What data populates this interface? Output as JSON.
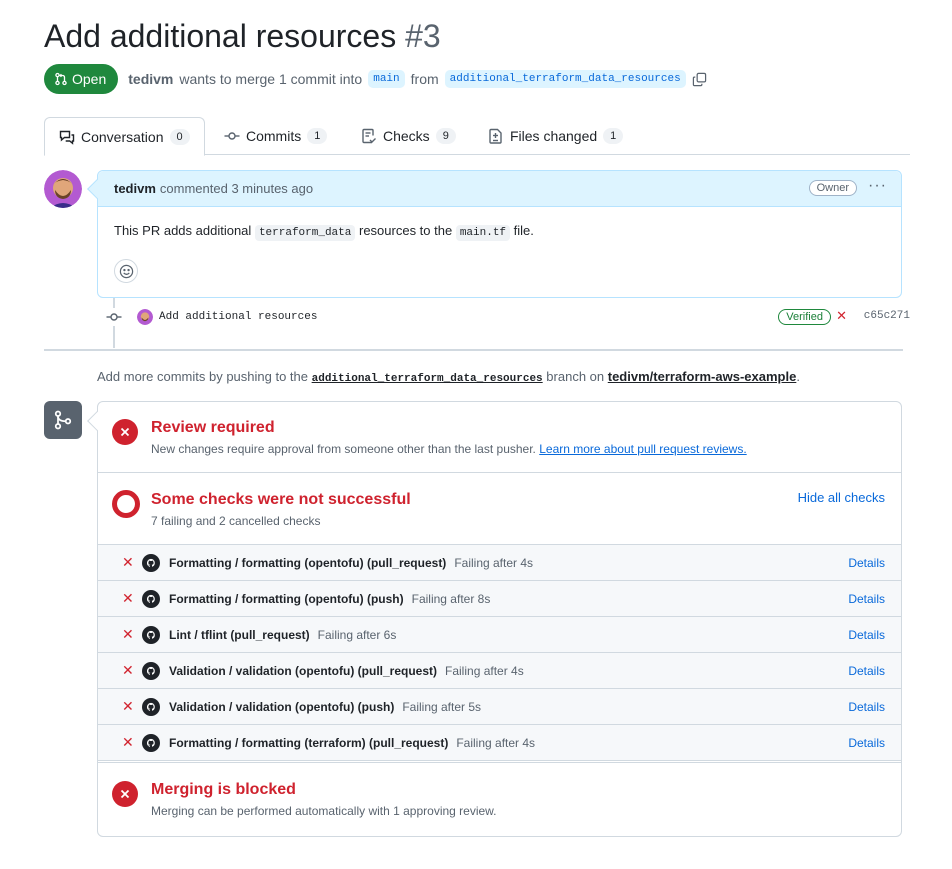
{
  "pr": {
    "title": "Add additional resources",
    "number": "#3",
    "state": "Open",
    "author": "tedivm",
    "merge_text": "wants to merge 1 commit into",
    "base_branch": "main",
    "from_text": "from",
    "head_branch": "additional_terraform_data_resources"
  },
  "tabs": [
    {
      "label": "Conversation",
      "count": "0"
    },
    {
      "label": "Commits",
      "count": "1"
    },
    {
      "label": "Checks",
      "count": "9"
    },
    {
      "label": "Files changed",
      "count": "1"
    }
  ],
  "comment": {
    "author": "tedivm",
    "time": "commented 3 minutes ago",
    "role": "Owner",
    "body_pre": "This PR adds additional",
    "code1": "terraform_data",
    "body_mid": "resources to the",
    "code2": "main.tf",
    "body_post": "file."
  },
  "commit": {
    "message": "Add additional resources",
    "verified": "Verified",
    "sha": "c65c271"
  },
  "more_commits": {
    "pre": "Add more commits by pushing to the",
    "branch": "additional_terraform_data_resources",
    "mid": "branch on",
    "repo": "tedivm/terraform-aws-example",
    "post": "."
  },
  "review": {
    "title": "Review required",
    "sub": "New changes require approval from someone other than the last pusher.",
    "link": "Learn more about pull request reviews."
  },
  "checks_summary": {
    "title": "Some checks were not successful",
    "sub": "7 failing and 2 cancelled checks",
    "hide": "Hide all checks"
  },
  "checks": [
    {
      "name": "Formatting / formatting (opentofu) (pull_request)",
      "status": "Failing after 4s",
      "details": "Details"
    },
    {
      "name": "Formatting / formatting (opentofu) (push)",
      "status": "Failing after 8s",
      "details": "Details"
    },
    {
      "name": "Lint / tflint (pull_request)",
      "status": "Failing after 6s",
      "details": "Details"
    },
    {
      "name": "Validation / validation (opentofu) (pull_request)",
      "status": "Failing after 4s",
      "details": "Details"
    },
    {
      "name": "Validation / validation (opentofu) (push)",
      "status": "Failing after 5s",
      "details": "Details"
    },
    {
      "name": "Formatting / formatting (terraform) (pull_request)",
      "status": "Failing after 4s",
      "details": "Details"
    }
  ],
  "blocked": {
    "title": "Merging is blocked",
    "sub": "Merging can be performed automatically with 1 approving review."
  },
  "colors": {
    "open_green": "#1f883d",
    "fail_red": "#cf222e",
    "link_blue": "#0969da",
    "comment_header_bg": "#ddf4ff"
  }
}
